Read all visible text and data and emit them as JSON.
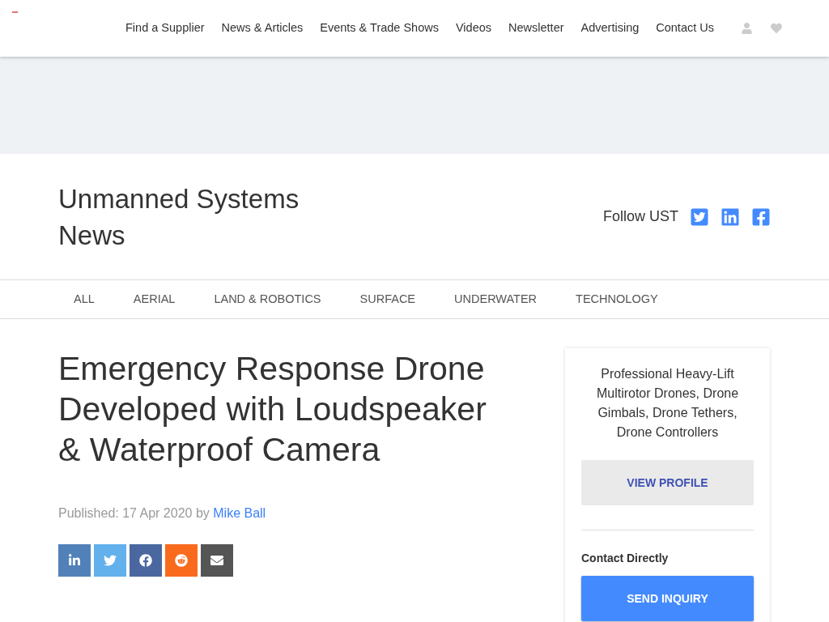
{
  "nav": {
    "items": [
      "Find a Supplier",
      "News & Articles",
      "Events & Trade Shows",
      "Videos",
      "Newsletter",
      "Advertising",
      "Contact Us"
    ]
  },
  "header": {
    "title": "Unmanned Systems News",
    "follow_label": "Follow UST",
    "social": [
      {
        "kind": "twitter"
      },
      {
        "kind": "linkedin"
      },
      {
        "kind": "facebook"
      }
    ]
  },
  "categories": [
    "ALL",
    "AERIAL",
    "LAND & ROBOTICS",
    "SURFACE",
    "UNDERWATER",
    "TECHNOLOGY"
  ],
  "article": {
    "title": "Emergency Response Drone Developed with Loudspeaker & Waterproof Camera",
    "published": "Published: 17 Apr 2020 by",
    "author": "Mike Ball",
    "share": [
      {
        "kind": "linkedin"
      },
      {
        "kind": "twitter"
      },
      {
        "kind": "facebook"
      },
      {
        "kind": "reddit"
      },
      {
        "kind": "email"
      }
    ]
  },
  "sidebar": {
    "description": "Professional Heavy-Lift Multirotor Drones, Drone Gimbals, Drone Tethers, Drone Controllers",
    "profile_button": "VIEW PROFILE",
    "contact_label": "Contact Directly",
    "inquiry_button": "SEND INQUIRY"
  }
}
